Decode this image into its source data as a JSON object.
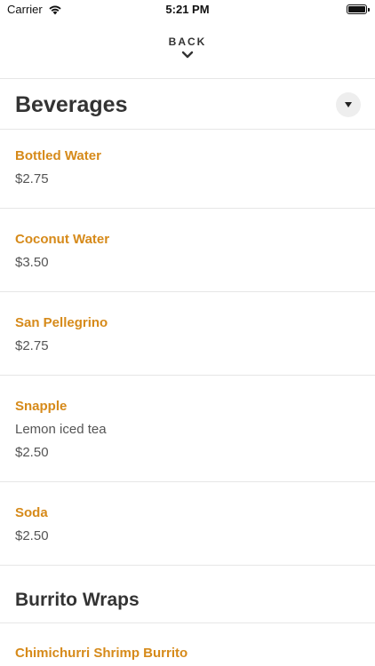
{
  "status": {
    "carrier": "Carrier",
    "time": "5:21 PM"
  },
  "nav": {
    "back_label": "BACK"
  },
  "sections": [
    {
      "title": "Beverages",
      "items": [
        {
          "name": "Bottled Water",
          "price": "$2.75"
        },
        {
          "name": "Coconut Water",
          "price": "$3.50"
        },
        {
          "name": "San Pellegrino",
          "price": "$2.75"
        },
        {
          "name": "Snapple",
          "description": "Lemon iced tea",
          "price": "$2.50"
        },
        {
          "name": "Soda",
          "price": "$2.50"
        }
      ]
    },
    {
      "title": "Burrito Wraps",
      "items": [
        {
          "name": "Chimichurri Shrimp Burrito"
        }
      ]
    }
  ],
  "colors": {
    "item_name": "#d68a1a",
    "divider": "#e6e6e6"
  },
  "icons": {
    "wifi": "wifi-icon",
    "battery": "battery-icon",
    "back": "chevron-down-icon",
    "dropdown": "dropdown-caret-icon"
  }
}
